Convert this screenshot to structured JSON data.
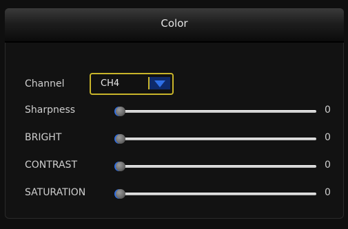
{
  "dialog": {
    "title": "Color"
  },
  "channel": {
    "label": "Channel",
    "selected": "CH4"
  },
  "settings": [
    {
      "label": "Sharpness",
      "value": "0",
      "level": 0
    },
    {
      "label": "BRIGHT",
      "value": "0",
      "level": 0
    },
    {
      "label": "CONTRAST",
      "value": "0",
      "level": 0
    },
    {
      "label": "SATURATION",
      "value": "0",
      "level": 0
    }
  ],
  "colors": {
    "select_border": "#c9b52a",
    "select_arrow_bg": "#0e2a6b",
    "select_arrow": "#2e6fe6"
  },
  "icons": {
    "dropdown": "chevron-down-icon"
  }
}
